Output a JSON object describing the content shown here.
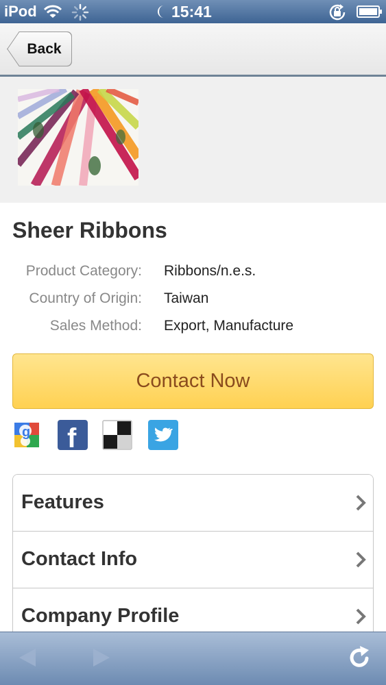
{
  "status_bar": {
    "carrier": "iPod",
    "time": "15:41",
    "icons": [
      "wifi-icon",
      "activity-spinner-icon",
      "moon-icon",
      "rotation-lock-icon",
      "battery-icon"
    ]
  },
  "nav": {
    "back_label": "Back"
  },
  "product": {
    "image_name": "sheer-ribbons-photo",
    "title": "Sheer Ribbons",
    "details": [
      {
        "label": "Product Category:",
        "value": "Ribbons/n.e.s."
      },
      {
        "label": "Country of Origin:",
        "value": "Taiwan"
      },
      {
        "label": "Sales Method:",
        "value": "Export, Manufacture"
      }
    ]
  },
  "contact_button": "Contact Now",
  "share_icons": [
    "google-icon",
    "facebook-icon",
    "delicious-icon",
    "twitter-icon"
  ],
  "menu": [
    {
      "label": "Features"
    },
    {
      "label": "Contact Info"
    },
    {
      "label": "Company Profile"
    }
  ],
  "toolbar": {
    "icons": [
      "back-arrow-icon",
      "forward-arrow-icon",
      "reload-icon"
    ]
  },
  "colors": {
    "status_bar": "#3e6494",
    "contact_button": "#ffd152",
    "contact_text": "#8a4b1d",
    "toolbar": "#6d8bb2"
  }
}
